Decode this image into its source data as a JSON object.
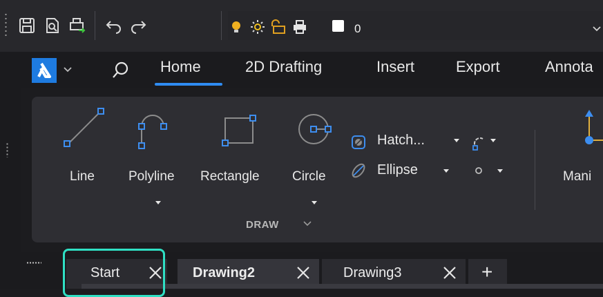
{
  "quick_access": {
    "icons": [
      "save-icon",
      "print-preview-icon",
      "plot-icon",
      "undo-icon",
      "redo-icon"
    ],
    "layer_bar": {
      "icons": [
        "lightbulb-icon",
        "sun-icon",
        "padlock-icon",
        "printer-icon"
      ],
      "color": "#ffffff",
      "layer_name": "0"
    }
  },
  "ribbon": {
    "tabs": [
      {
        "label": "Home",
        "active": true
      },
      {
        "label": "2D Drafting"
      },
      {
        "label": "Insert"
      },
      {
        "label": "Export"
      },
      {
        "label": "Annota"
      }
    ],
    "accent_color": "#2f8cf2",
    "panel": {
      "title": "DRAW",
      "tools": [
        {
          "label": "Line",
          "icon": "line-icon"
        },
        {
          "label": "Polyline",
          "icon": "polyline-icon"
        },
        {
          "label": "Rectangle",
          "icon": "rectangle-icon"
        },
        {
          "label": "Circle",
          "icon": "circle-icon"
        }
      ],
      "small_tools": [
        {
          "label": "Hatch...",
          "icon": "hatch-icon"
        },
        {
          "label": "Ellipse",
          "icon": "ellipse-icon"
        }
      ],
      "extra_icons": [
        "revcloud-icon",
        "point-icon"
      ],
      "next_tool": {
        "label": "Mani",
        "icon": "manipulate-icon"
      }
    }
  },
  "document_tabs": {
    "tabs": [
      {
        "label": "Start",
        "bold": false
      },
      {
        "label": "Drawing2",
        "bold": true
      },
      {
        "label": "Drawing3",
        "bold": false
      }
    ],
    "add_label": "+",
    "highlight_color": "#2fe0c4"
  }
}
